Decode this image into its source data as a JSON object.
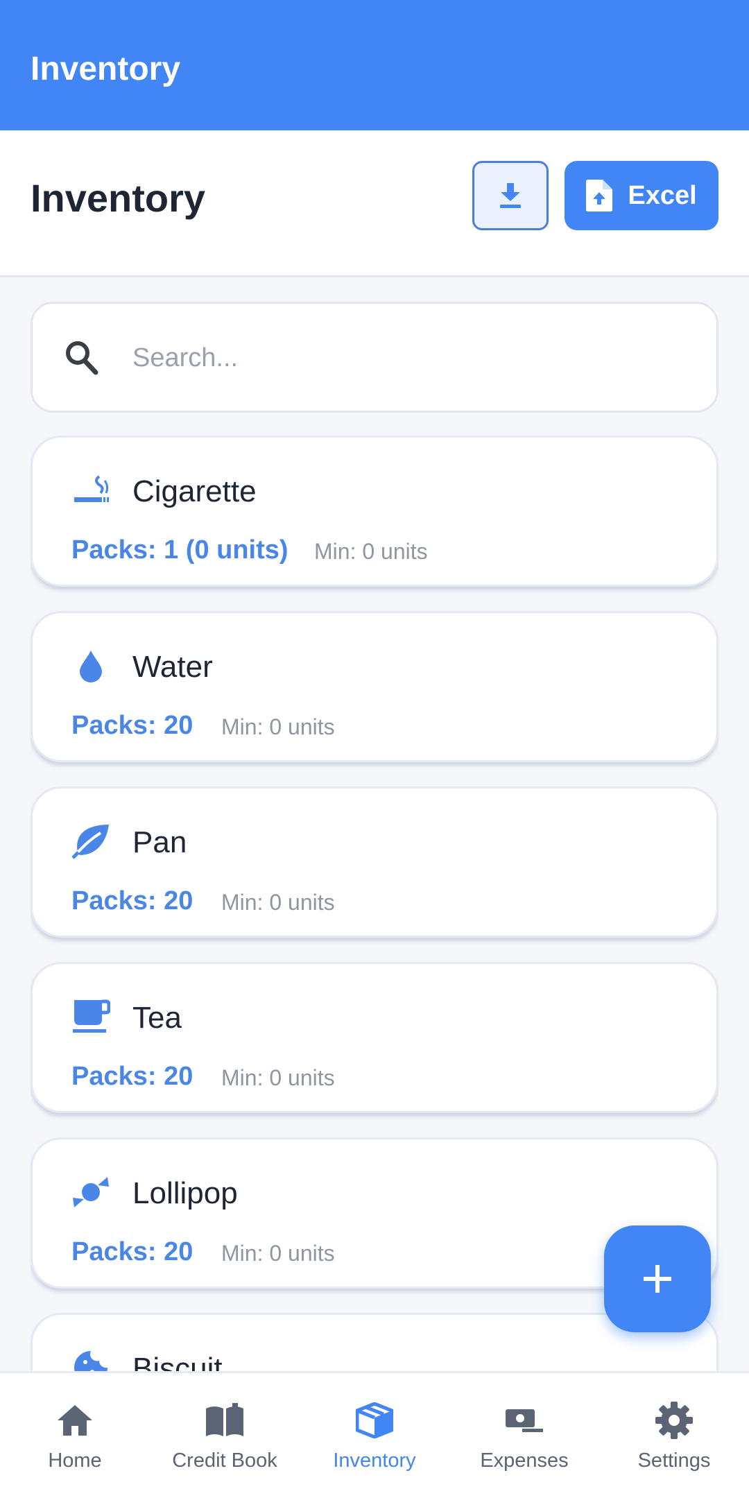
{
  "app_bar": {
    "title": "Inventory"
  },
  "header": {
    "title": "Inventory",
    "download_icon": "download-icon",
    "excel_label": "Excel",
    "excel_icon": "file-upload-icon"
  },
  "search": {
    "placeholder": "Search...",
    "value": "",
    "icon": "search-icon"
  },
  "items": [
    {
      "name": "Cigarette",
      "packs": "Packs: 1 (0 units)",
      "min": "Min: 0 units",
      "icon": "smoking-icon"
    },
    {
      "name": "Water",
      "packs": "Packs: 20",
      "min": "Min: 0 units",
      "icon": "water-drop-icon"
    },
    {
      "name": "Pan",
      "packs": "Packs: 20",
      "min": "Min: 0 units",
      "icon": "leaf-icon"
    },
    {
      "name": "Tea",
      "packs": "Packs: 20",
      "min": "Min: 0 units",
      "icon": "cup-icon"
    },
    {
      "name": "Lollipop",
      "packs": "Packs: 20",
      "min": "Min: 0 units",
      "icon": "candy-icon"
    },
    {
      "name": "Biscuit",
      "icon": "cookie-icon"
    }
  ],
  "fab": {
    "icon": "plus-icon"
  },
  "nav": [
    {
      "label": "Home",
      "icon": "home-icon",
      "active": false
    },
    {
      "label": "Credit Book",
      "icon": "book-icon",
      "active": false
    },
    {
      "label": "Inventory",
      "icon": "box-icon",
      "active": true
    },
    {
      "label": "Expenses",
      "icon": "money-icon",
      "active": false
    },
    {
      "label": "Settings",
      "icon": "gear-icon",
      "active": false
    }
  ],
  "colors": {
    "primary": "#4285F4",
    "packs_text": "#4A86E8",
    "muted_text": "#8E96A3",
    "nav_inactive": "#5B6474"
  }
}
